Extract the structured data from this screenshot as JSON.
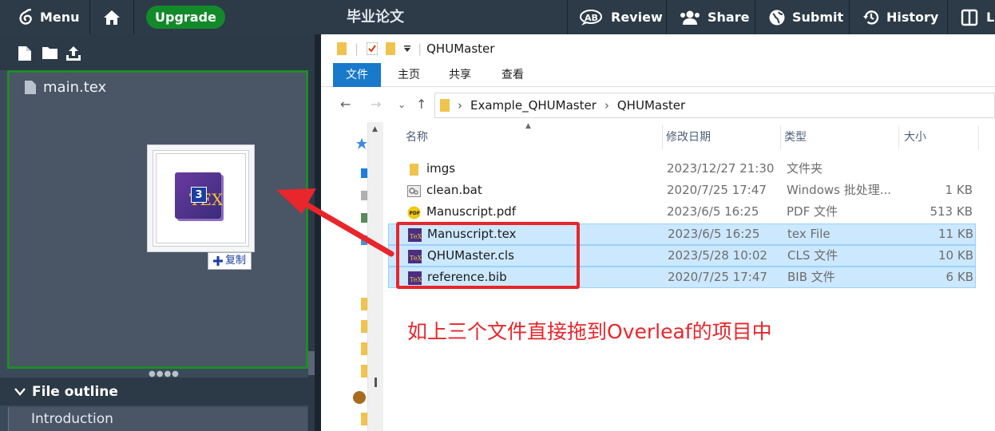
{
  "topbar": {
    "menu_label": "Menu",
    "upgrade_label": "Upgrade",
    "project_title": "毕业论文",
    "review_label": "Review",
    "share_label": "Share",
    "submit_label": "Submit",
    "history_label": "History",
    "layout_label": "La"
  },
  "file_tree": {
    "files": [
      "main.tex"
    ],
    "drag_count": "3",
    "drag_tooltip": "复制"
  },
  "outline": {
    "header": "File outline",
    "items": [
      "Introduction"
    ]
  },
  "explorer": {
    "title": "QHUMaster",
    "ribbon_tabs": [
      "文件",
      "主页",
      "共享",
      "查看"
    ],
    "breadcrumb": [
      "Example_QHUMaster",
      "QHUMaster"
    ],
    "columns": [
      "名称",
      "修改日期",
      "类型",
      "大小"
    ],
    "rows": [
      {
        "name": "imgs",
        "date": "2023/12/27 21:30",
        "type": "文件夹",
        "size": "",
        "icon": "folder-icon",
        "selected": false
      },
      {
        "name": "clean.bat",
        "date": "2020/7/25 17:47",
        "type": "Windows 批处理...",
        "size": "1 KB",
        "icon": "bat-file-icon",
        "selected": false
      },
      {
        "name": "Manuscript.pdf",
        "date": "2023/6/5 16:25",
        "type": "PDF 文件",
        "size": "513 KB",
        "icon": "pdf-file-icon",
        "selected": false
      },
      {
        "name": "Manuscript.tex",
        "date": "2023/6/5 16:25",
        "type": "tex File",
        "size": "11 KB",
        "icon": "tex-file-icon",
        "selected": true
      },
      {
        "name": "QHUMaster.cls",
        "date": "2023/5/28 10:02",
        "type": "CLS 文件",
        "size": "10 KB",
        "icon": "tex-file-icon",
        "selected": true
      },
      {
        "name": "reference.bib",
        "date": "2020/7/25 17:47",
        "type": "BIB 文件",
        "size": "6 KB",
        "icon": "tex-file-icon",
        "selected": true
      }
    ]
  },
  "annotation": "如上三个文件直接拖到Overleaf的项目中",
  "colors": {
    "overleaf_dark": "#2d3a47",
    "upgrade_green": "#138a2a",
    "selection_blue": "#cce8ff",
    "annotation_red": "#e8262b",
    "ribbon_blue": "#1979ca"
  }
}
